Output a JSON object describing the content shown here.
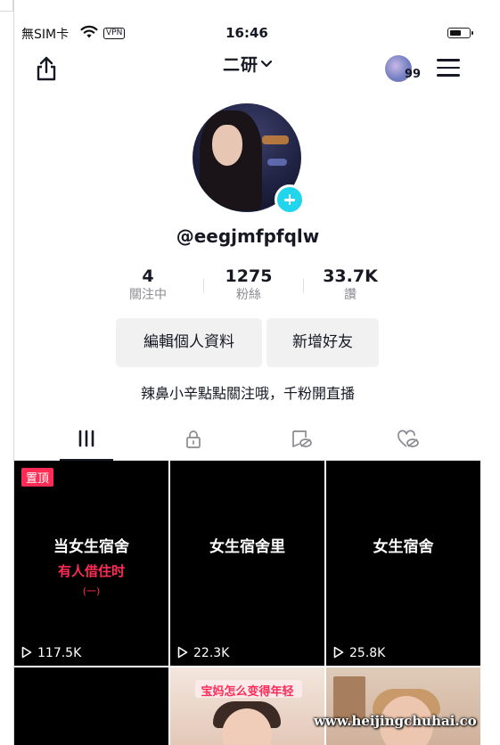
{
  "status_bar": {
    "carrier": "無SIM卡",
    "vpn": "VPN",
    "time": "16:46",
    "battery_level": 0.6
  },
  "header": {
    "title": "二研",
    "badge_count": "99",
    "icons": {
      "share": "share-icon",
      "chevron": "chevron-down-icon",
      "menu": "menu-icon"
    }
  },
  "profile": {
    "username": "@eegjmfpfqlw",
    "stats": [
      {
        "value": "4",
        "label": "關注中"
      },
      {
        "value": "1275",
        "label": "粉絲"
      },
      {
        "value": "33.7K",
        "label": "讚"
      }
    ],
    "edit_button": "編輯個人資料",
    "add_friend_button": "新增好友",
    "bio": "辣鼻小辛點點關注哦，千粉開直播"
  },
  "tabs": [
    {
      "icon": "videos-grid-icon",
      "active": true
    },
    {
      "icon": "lock-icon",
      "active": false
    },
    {
      "icon": "reposts-icon",
      "active": false
    },
    {
      "icon": "liked-hidden-icon",
      "active": false
    }
  ],
  "videos": [
    {
      "pinned_label": "置頂",
      "line1": "当女生宿舍",
      "line2": "有人借住时",
      "line3": "(一)",
      "views": "117.5K"
    },
    {
      "line1": "女生宿舍里",
      "views": "22.3K"
    },
    {
      "line1": "女生宿舍",
      "views": "25.8K"
    }
  ],
  "partial_videos": [
    {
      "caption": ""
    },
    {
      "caption": "宝妈怎么变得年轻"
    },
    {
      "caption": ""
    }
  ],
  "watermark": "www.heijingchuhai.co",
  "colors": {
    "accent": "#fe2c55",
    "follow": "#20d5ec",
    "text": "#161823",
    "muted": "#8a8b91"
  }
}
